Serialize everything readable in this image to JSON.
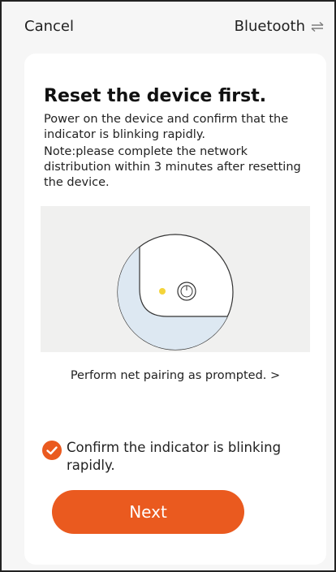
{
  "header": {
    "cancel_label": "Cancel",
    "mode_label": "Bluetooth",
    "mode_icon": "swap-arrows-icon"
  },
  "content": {
    "title": "Reset the device first.",
    "description": "Power on the device and confirm that the indicator is blinking rapidly.",
    "note": "Note:please complete the network distribution within 3 minutes after resetting the device.",
    "pairing_link": "Perform net pairing as prompted. >",
    "confirm_label": "Confirm the indicator is blinking rapidly.",
    "confirm_checked": true,
    "next_label": "Next"
  },
  "colors": {
    "accent": "#ea5a1f",
    "indicator_led": "#f4d43a",
    "device_face": "#dde8f2",
    "background": "#f6f6f6"
  }
}
